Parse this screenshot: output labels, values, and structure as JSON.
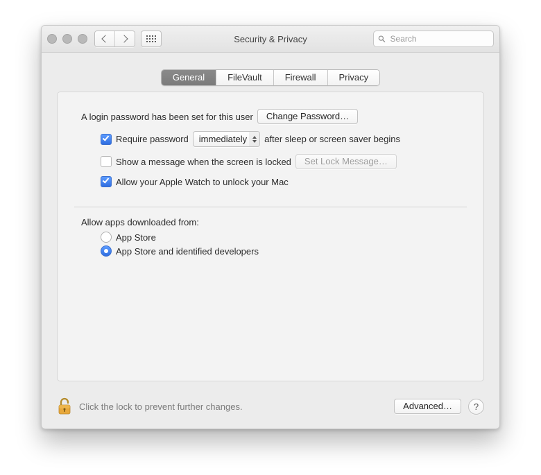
{
  "window": {
    "title": "Security & Privacy",
    "search_placeholder": "Search"
  },
  "tabs": [
    {
      "label": "General",
      "active": true
    },
    {
      "label": "FileVault",
      "active": false
    },
    {
      "label": "Firewall",
      "active": false
    },
    {
      "label": "Privacy",
      "active": false
    }
  ],
  "general": {
    "login_password_set_text": "A login password has been set for this user",
    "change_password_label": "Change Password…",
    "require_password": {
      "label_before": "Require password",
      "delay_selected": "immediately",
      "label_after": "after sleep or screen saver begins",
      "checked": true
    },
    "show_message": {
      "label": "Show a message when the screen is locked",
      "checked": false,
      "button_label": "Set Lock Message…",
      "button_disabled": true
    },
    "apple_watch": {
      "label": "Allow your Apple Watch to unlock your Mac",
      "checked": true
    },
    "allow_apps_heading": "Allow apps downloaded from:",
    "allow_apps_options": [
      {
        "label": "App Store",
        "selected": false
      },
      {
        "label": "App Store and identified developers",
        "selected": true
      }
    ]
  },
  "footer": {
    "lock_hint": "Click the lock to prevent further changes.",
    "advanced_label": "Advanced…",
    "help_label": "?"
  }
}
